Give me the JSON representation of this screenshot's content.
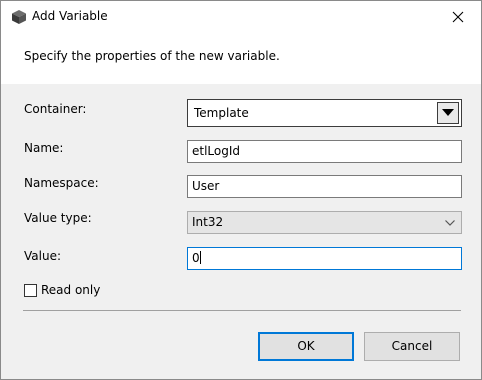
{
  "window": {
    "title": "Add Variable",
    "icon": "variable-cube-icon",
    "close_icon": "close-icon"
  },
  "header": {
    "description": "Specify the properties of the new variable."
  },
  "form": {
    "container": {
      "label": "Container:",
      "value": "Template"
    },
    "name": {
      "label": "Name:",
      "value": "etlLogId"
    },
    "namespace": {
      "label": "Namespace:",
      "value": "User"
    },
    "value_type": {
      "label": "Value type:",
      "value": "Int32"
    },
    "value": {
      "label": "Value:",
      "value": "0"
    },
    "read_only": {
      "label": "Read only",
      "checked": false
    }
  },
  "buttons": {
    "ok": "OK",
    "cancel": "Cancel"
  },
  "colors": {
    "accent": "#0078d7",
    "dialog_bg": "#f0f0f0",
    "header_bg": "#ffffff"
  }
}
